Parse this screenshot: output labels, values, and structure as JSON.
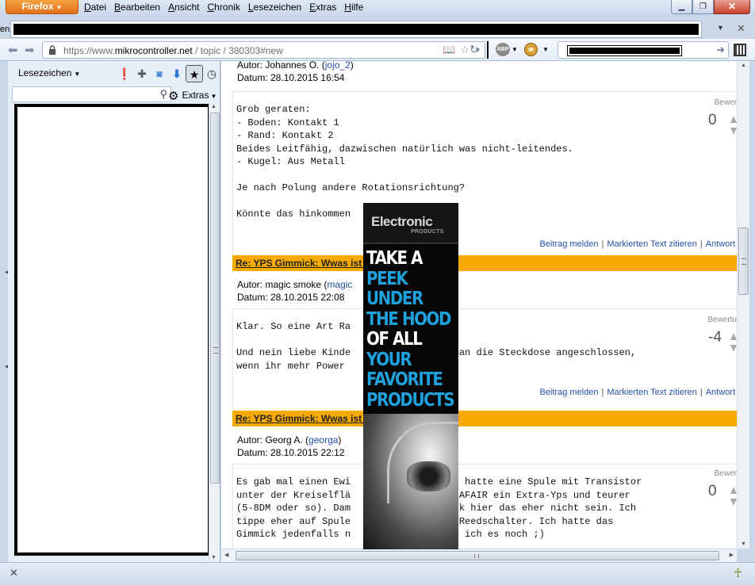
{
  "titlebar": {
    "firefox_button": "Firefox",
    "menu": [
      "Datei",
      "Bearbeiten",
      "Ansicht",
      "Chronik",
      "Lesezeichen",
      "Extras",
      "Hilfe"
    ]
  },
  "tab": {
    "left_fragment": "en"
  },
  "navbar": {
    "url_prefix": "https://www.",
    "url_host": "mikrocontroller.net",
    "url_path": " / topic / 380303#new"
  },
  "sidebar": {
    "title": "Lesezeichen",
    "extras_label": "Extras"
  },
  "posts": [
    {
      "header": "",
      "author_label": "Autor: Johannes O. (",
      "author_user": "jojo_2",
      "author_close": ")",
      "date": "Datum: 28.10.2015 16:54",
      "body": "Grob geraten:\n- Boden: Kontakt 1\n- Rand: Kontakt 2\nBeides Leitfähig, dazwischen natürlich was nicht-leitendes.\n- Kugel: Aus Metall\n\nJe nach Polung andere Rotationsrichtung?\n\nKönnte das hinkommen",
      "rating_label": "Bewer",
      "rating_value": "0"
    },
    {
      "header": "Re: YPS Gimmick: Wwas ist d",
      "author_label": "Autor: magic smoke (",
      "author_user": "magic",
      "author_close": "",
      "date": "Datum: 28.10.2015 22:08",
      "body": "Klar. So eine Art Ra\n\nUnd nein liebe Kinde                HT an die Steckdose angeschlossen,\nwenn ihr mehr Power",
      "rating_label": "Bewertu",
      "rating_value": "-4"
    },
    {
      "header": "Re: YPS Gimmick: Wwas ist d",
      "author_label": "Autor: Georg A. (",
      "author_user": "georga",
      "author_close": ")",
      "date": "Datum: 28.10.2015 22:12",
      "body": "Es gab mal einen Ewi                der hatte eine Spule mit Transistor\nunter der Kreiselflä                er AFAIR ein Extra-Yps und teurer\n(5-8DM oder so). Dam                mick hier das eher nicht sein. Ich\ntippe eher auf Spule                nd Reedschalter. Ich hatte das\nGimmick jedenfalls n                ste ich es noch ;)",
      "rating_label": "Bewer",
      "rating_value": "0"
    }
  ],
  "actions": {
    "report": "Beitrag melden",
    "quote": "Markierten Text zitieren",
    "reply": "Antwort",
    "separator": "|"
  },
  "ad": {
    "brand": "Electronic",
    "brand_sub": "PRODUCTS",
    "lines": [
      {
        "text": "TAKE A",
        "color": "white"
      },
      {
        "text": "PEEK",
        "color": "blue"
      },
      {
        "text": "UNDER",
        "color": "blue"
      },
      {
        "text": "THE HOOD",
        "color": "blue"
      },
      {
        "text": "OF ALL",
        "color": "white"
      },
      {
        "text": "YOUR",
        "color": "blue"
      },
      {
        "text": "FAVORITE",
        "color": "blue"
      },
      {
        "text": "PRODUCTS",
        "color": "blue"
      }
    ]
  },
  "colors": {
    "post_header": "#f6aa00",
    "link": "#2451a7",
    "ad_blue": "#1ea1dc",
    "firefox_orange": "#e0701a"
  }
}
